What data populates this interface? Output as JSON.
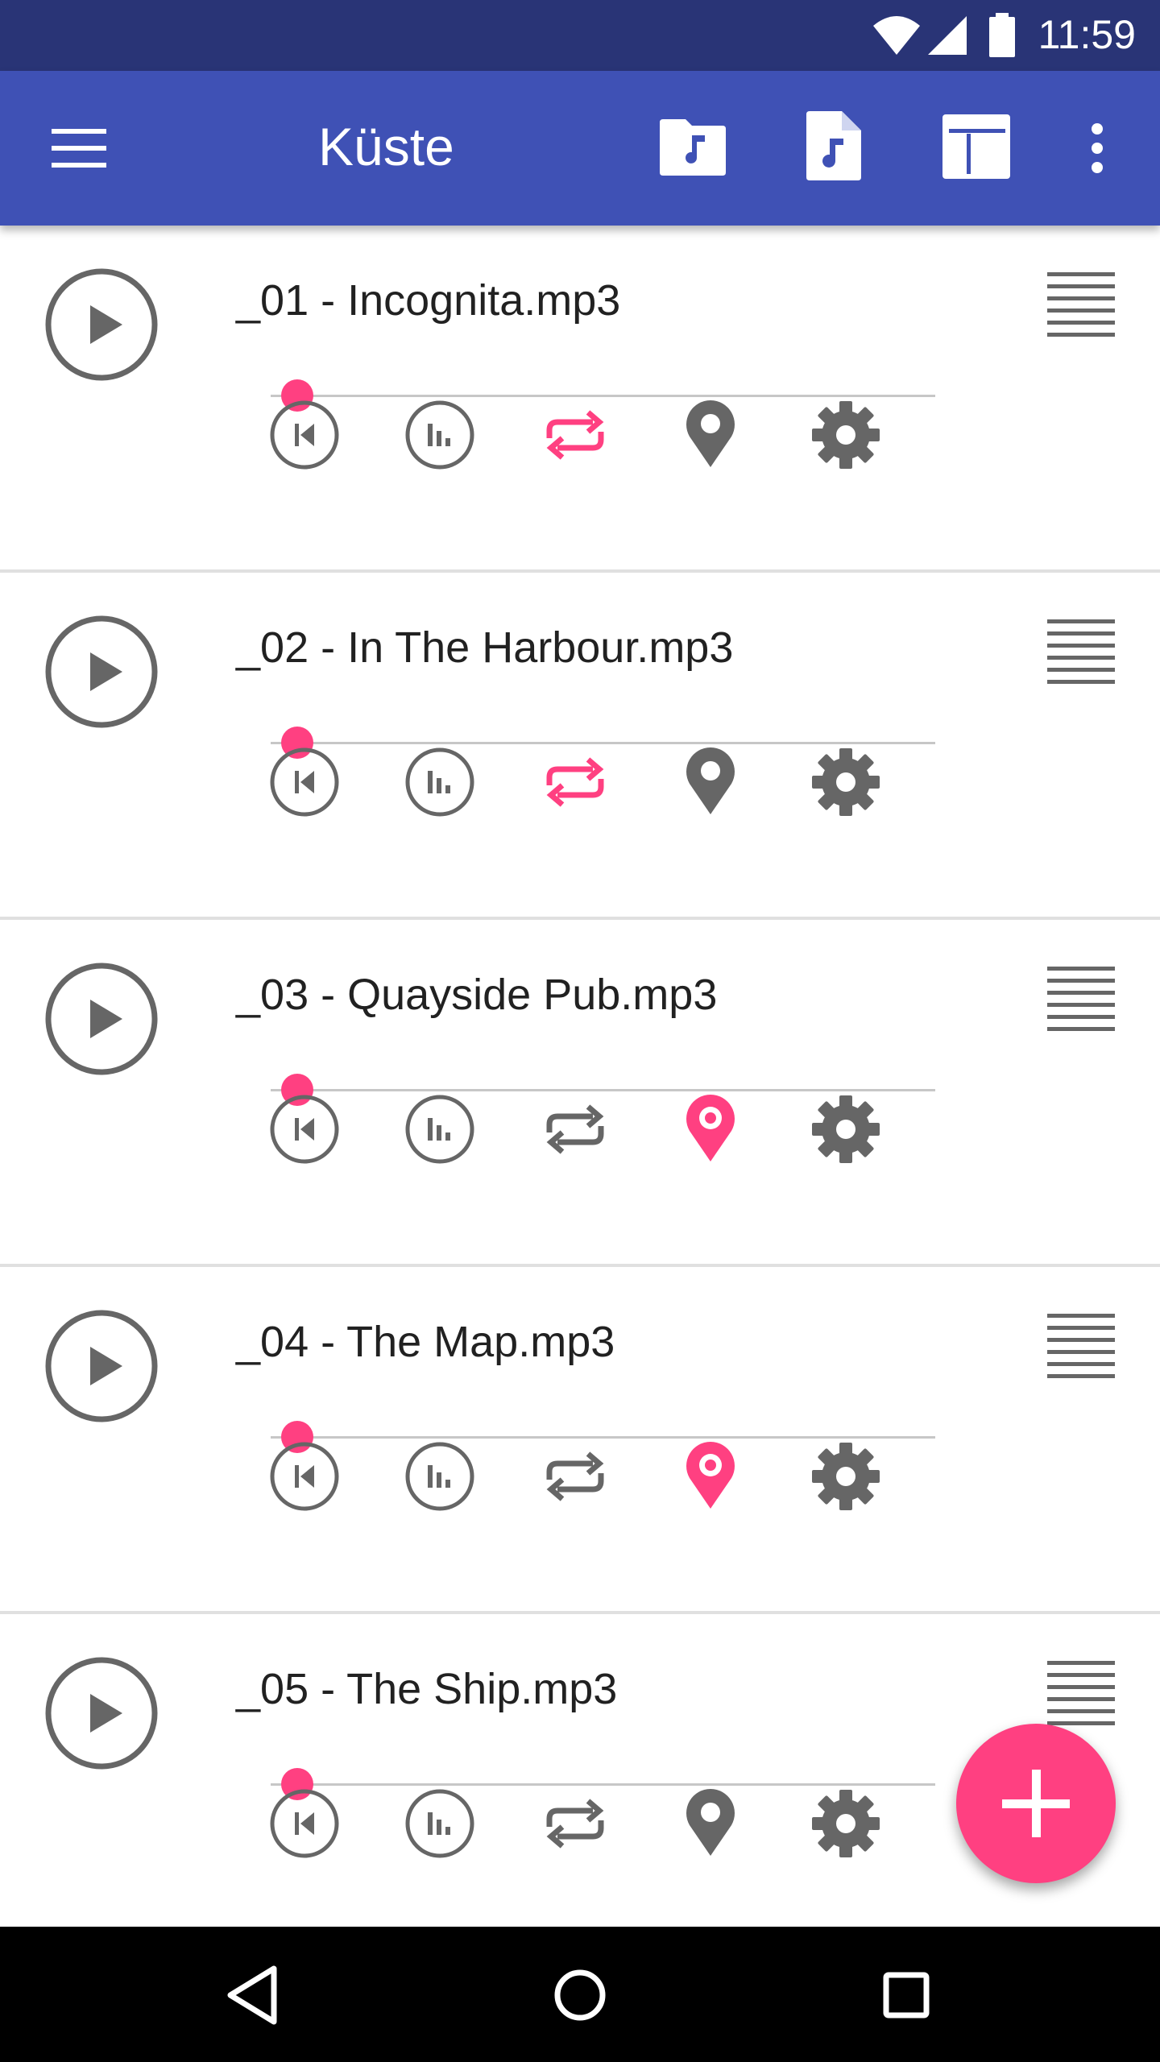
{
  "status_bar": {
    "time": "11:59",
    "icons": [
      "wifi-icon",
      "cell-signal-icon",
      "battery-icon"
    ]
  },
  "app_bar": {
    "title": "Küste",
    "actions": [
      "menu-icon",
      "music-folder-icon",
      "music-file-icon",
      "layout-icon",
      "more-vert-icon"
    ]
  },
  "colors": {
    "primary": "#3f51b5",
    "primary_dark": "#293476",
    "accent": "#ff4081",
    "icon_grey": "#666666"
  },
  "tracks": [
    {
      "title": "_01 - Incognita.mp3",
      "progress": 0.04,
      "loop_active": true,
      "location_active": false
    },
    {
      "title": "_02 - In The Harbour.mp3",
      "progress": 0.04,
      "loop_active": true,
      "location_active": false
    },
    {
      "title": "_03 - Quayside Pub.mp3",
      "progress": 0.04,
      "loop_active": false,
      "location_active": true
    },
    {
      "title": "_04 - The Map.mp3",
      "progress": 0.04,
      "loop_active": false,
      "location_active": true
    },
    {
      "title": "_05 - The Ship.mp3",
      "progress": 0.04,
      "loop_active": false,
      "location_active": false
    }
  ],
  "fab": {
    "icon": "add-icon"
  },
  "nav_bar": {
    "buttons": [
      "back-icon",
      "home-icon",
      "recents-icon"
    ]
  }
}
